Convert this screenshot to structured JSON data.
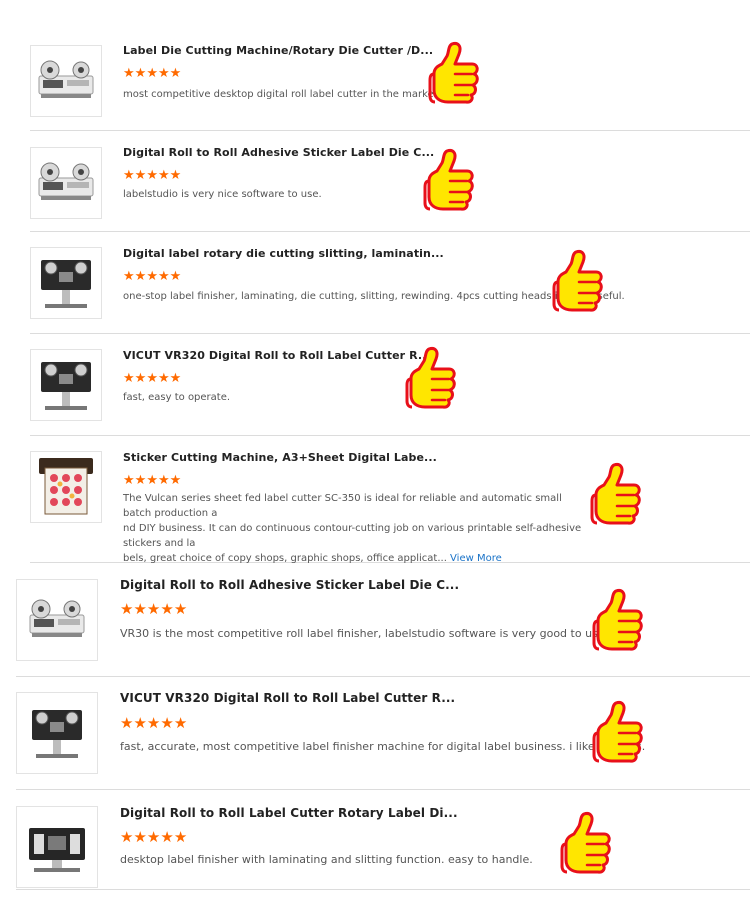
{
  "reviews": [
    {
      "title": "Label Die Cutting Machine/Rotary Die Cutter /D...",
      "rating": 5,
      "text": "most competitive desktop digital roll label cutter in the market.",
      "image": "desktop-label-cutter-white"
    },
    {
      "title": "Digital Roll to Roll Adhesive Sticker Label Die C...",
      "rating": 5,
      "text": "labelstudio is very nice software to use.",
      "image": "desktop-label-cutter-white"
    },
    {
      "title": "Digital label rotary die cutting slitting, laminatin...",
      "rating": 5,
      "text": "one-stop label finisher, laminating, die cutting, slitting, rewinding. 4pcs cutting heads is very useful.",
      "image": "label-finisher-black"
    },
    {
      "title": "VICUT VR320 Digital Roll to Roll Label Cutter R...",
      "rating": 5,
      "text": "fast, easy to operate.",
      "image": "label-finisher-black"
    },
    {
      "title": "Sticker Cutting Machine, A3+Sheet Digital Labe...",
      "rating": 5,
      "text": "The Vulcan series sheet fed label cutter SC-350 is ideal for reliable and automatic small batch production and DIY business. It can do continuous contour-cutting job on various printable self-adhesive stickers and labels, great choice of copy shops, graphic shops, office applicat...",
      "text_lines": [
        "The Vulcan series sheet fed label cutter SC-350 is ideal for reliable and automatic small batch production a",
        "nd DIY business. It can do continuous contour-cutting job on various printable self-adhesive stickers and la",
        "bels, great choice of copy shops, graphic shops, office applicat..."
      ],
      "more_label": "View More",
      "image": "sheet-cutter"
    },
    {
      "title": "Digital Roll to Roll Adhesive Sticker Label Die C...",
      "rating": 5,
      "text": "VR30 is the most competitive roll label finisher, labelstudio software is very good to use.",
      "image": "desktop-label-cutter-white"
    },
    {
      "title": "VICUT VR320 Digital Roll to Roll Label Cutter R...",
      "rating": 5,
      "text": "fast, accurate, most competitive label finisher machine for digital label business. i like 4 heads.",
      "image": "label-finisher-black"
    },
    {
      "title": "Digital Roll to Roll Label Cutter Rotary Label Di...",
      "rating": 5,
      "text": "desktop label finisher with laminating and slitting function. easy to handle.",
      "image": "label-finisher-black-wide"
    }
  ],
  "star_char": "★",
  "thumbs_up_icon": "thumbs-up-icon",
  "colors": {
    "star": "#ff6a00",
    "thumb_fill": "#ffe600",
    "thumb_outline": "#e8101a",
    "link": "#1a73c8",
    "divider": "#dcdcdc"
  }
}
